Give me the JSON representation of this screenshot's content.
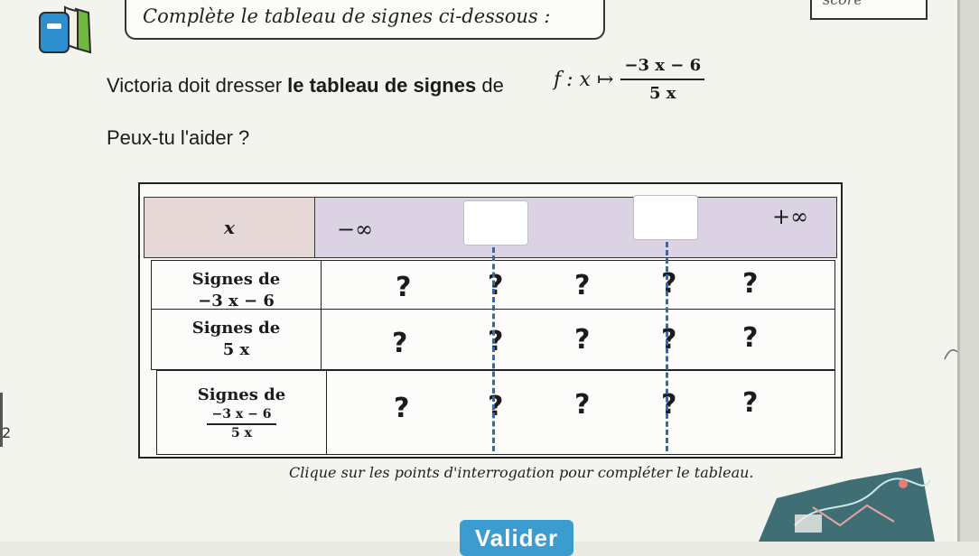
{
  "header": {
    "title": "Complète le tableau de signes ci-dessous :",
    "score_label": "score"
  },
  "statement": {
    "prefix": "Victoria doit dresser",
    "bold": "le tableau de signes",
    "suffix": "de",
    "func_name": "f",
    "mapping": ": x ↦",
    "numerator": "−3 x − 6",
    "denominator": "5 x"
  },
  "question": "Peux-tu l'aider ?",
  "table": {
    "header_label": "x",
    "minus_infinity": "−∞",
    "plus_infinity": "+∞",
    "rows": [
      {
        "label_line1": "Signes de",
        "label_line2": "−3 x − 6",
        "cells": [
          "?",
          "?",
          "?",
          "?",
          "?"
        ]
      },
      {
        "label_line1": "Signes de",
        "label_line2": "5 x",
        "cells": [
          "?",
          "?",
          "?",
          "?",
          "?"
        ]
      },
      {
        "label_line1": "Signes de",
        "label_num": "−3 x − 6",
        "label_den": "5 x",
        "cells": [
          "?",
          "?",
          "?",
          "?",
          "?"
        ]
      }
    ]
  },
  "caption": "Clique sur les points d'interrogation pour compléter le tableau.",
  "validate_label": "Valider",
  "left_edge_number": "2",
  "icons": [
    "book-icon",
    "math-decoration-icon"
  ],
  "colors": {
    "header_x_bg": "#e7d8d8",
    "header_row_bg": "#dbd2e4",
    "dash": "#2a6ab8",
    "button": "#3c9ccf"
  }
}
